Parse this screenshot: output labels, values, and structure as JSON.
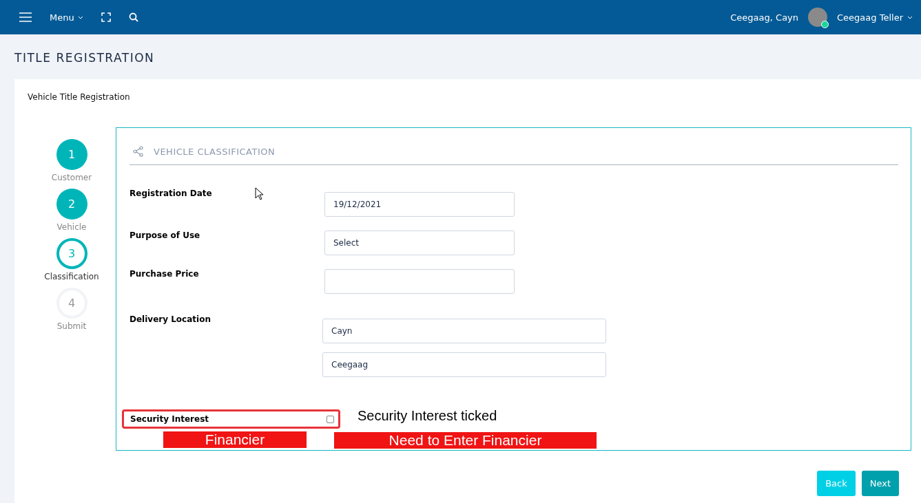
{
  "topbar": {
    "menu_label": "Menu",
    "user_name": "Ceegaag, Cayn",
    "role": "Ceegaag Teller",
    "online": true
  },
  "page_title": "TITLE REGISTRATION",
  "card_title": "Vehicle Title Registration",
  "steps": [
    {
      "number": "1",
      "label": "Customer",
      "completed": true,
      "selected": false
    },
    {
      "number": "2",
      "label": "Vehicle",
      "completed": true,
      "selected": false
    },
    {
      "number": "3",
      "label": "Classification",
      "completed": false,
      "selected": true
    },
    {
      "number": "4",
      "label": "Submit",
      "completed": false,
      "selected": false
    }
  ],
  "section_title": "VEHICLE CLASSIFICATION",
  "fields": [
    {
      "label": "Registration Date",
      "values": [
        "19/12/2021"
      ],
      "kind": "short"
    },
    {
      "label": "Purpose of Use",
      "values": [
        "Select"
      ],
      "kind": "short"
    },
    {
      "label": "Purchase Price",
      "kind": "short"
    },
    {
      "label": "Delivery Location",
      "values": [
        "Cayn",
        "Ceegaag"
      ],
      "kind": "wide"
    }
  ],
  "security_interest": {
    "label": "Security Interest",
    "checked": false
  },
  "annotations": [
    {
      "text": "Security Interest ticked",
      "kind": "outlined"
    },
    {
      "text": "Financier",
      "kind": "red-box"
    },
    {
      "text": "Need to Enter Financier",
      "kind": "red-box"
    }
  ],
  "buttons": [
    {
      "label": "Back",
      "kind": "secondary"
    },
    {
      "label": "Next",
      "kind": "primary"
    }
  ]
}
